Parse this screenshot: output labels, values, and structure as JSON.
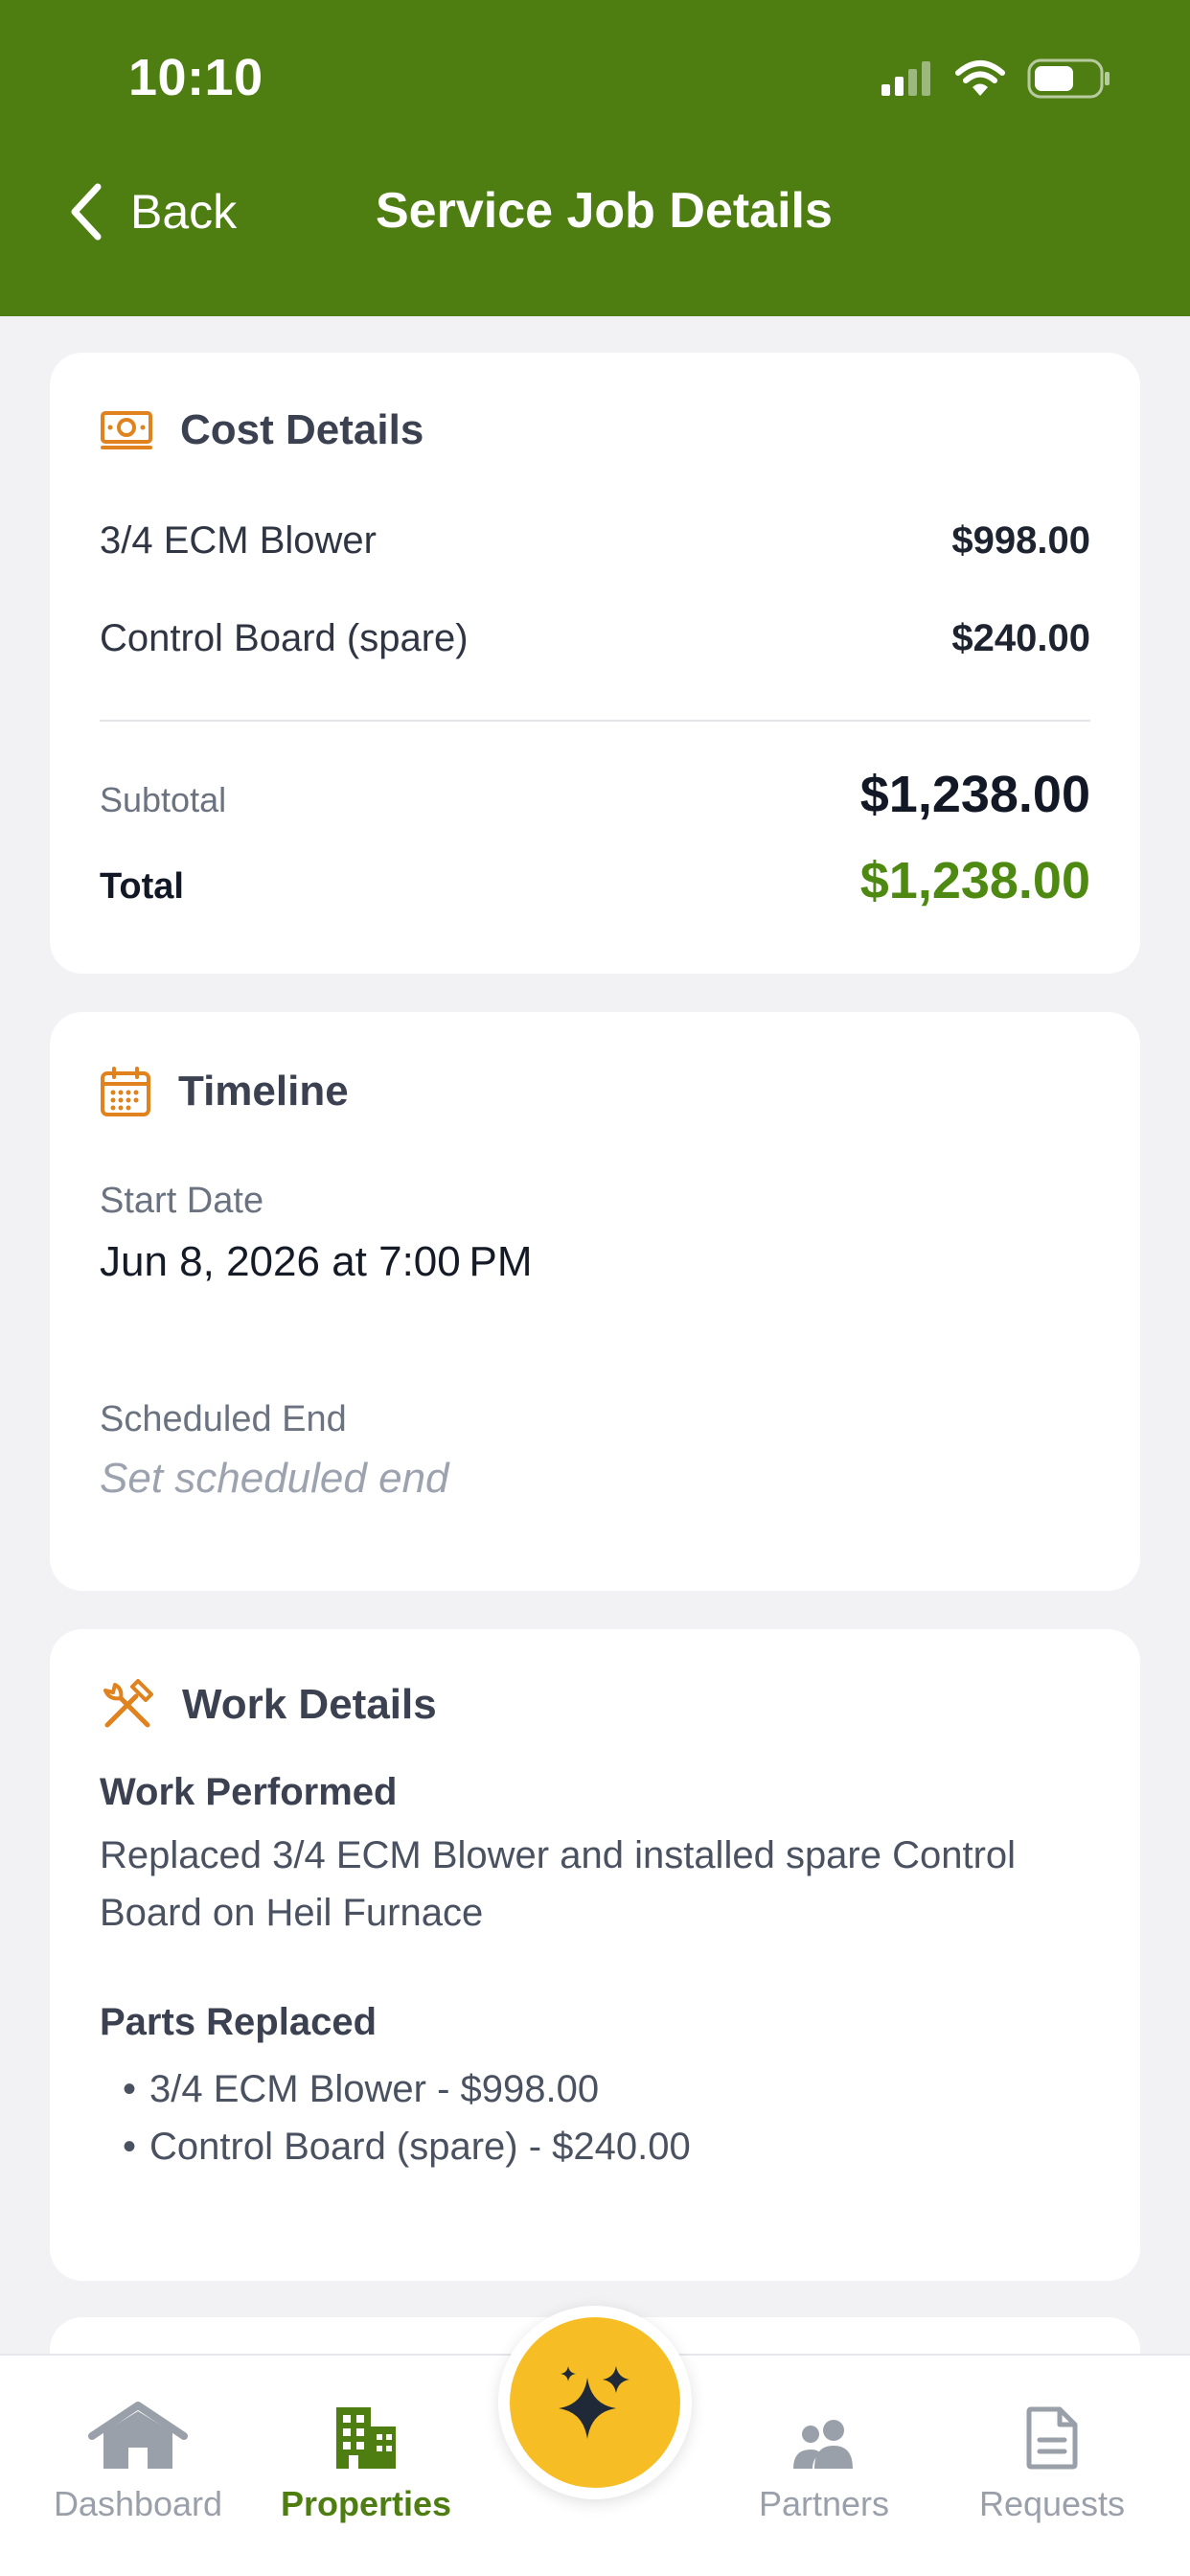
{
  "status_bar": {
    "time": "10:10"
  },
  "header": {
    "back_label": "Back",
    "title": "Service Job Details"
  },
  "cost_details": {
    "title": "Cost Details",
    "items": [
      {
        "label": "3/4 ECM Blower",
        "value": "$998.00"
      },
      {
        "label": "Control Board (spare)",
        "value": "$240.00"
      }
    ],
    "subtotal_label": "Subtotal",
    "subtotal_value": "$1,238.00",
    "total_label": "Total",
    "total_value": "$1,238.00"
  },
  "timeline": {
    "title": "Timeline",
    "start_label": "Start Date",
    "start_value": "Jun 8, 2026 at 7:00 PM",
    "end_label": "Scheduled End",
    "end_placeholder": "Set scheduled end"
  },
  "work_details": {
    "title": "Work Details",
    "performed_label": "Work Performed",
    "performed_text": "Replaced 3/4 ECM Blower and installed spare Control Board on Heil Furnace",
    "parts_label": "Parts Replaced",
    "parts": [
      "3/4 ECM Blower - $998.00",
      "Control Board (spare) - $240.00"
    ]
  },
  "tabbar": {
    "tabs": [
      {
        "label": "Dashboard",
        "icon": "house-icon"
      },
      {
        "label": "Properties",
        "icon": "building-icon",
        "active": true
      },
      {
        "label": "Partners",
        "icon": "people-icon"
      },
      {
        "label": "Requests",
        "icon": "document-icon"
      }
    ],
    "center_action_icon": "sparkles-icon"
  },
  "colors": {
    "header_bg": "#4e7e12",
    "accent_green": "#4e8a12",
    "icon_orange": "#e0821d",
    "fab_yellow": "#f7bd24"
  }
}
